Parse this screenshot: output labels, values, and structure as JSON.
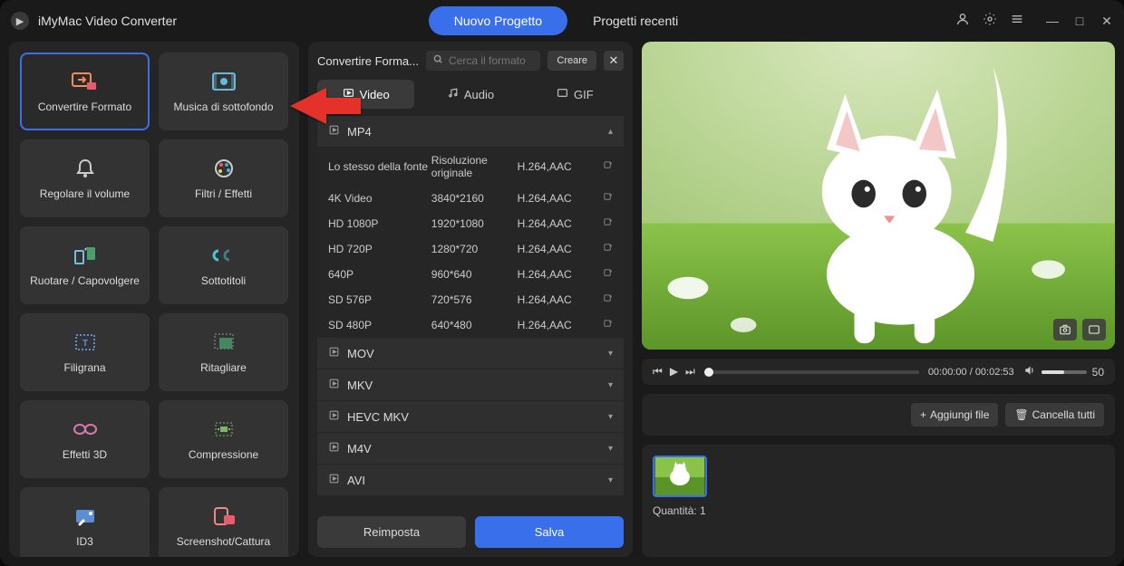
{
  "app": {
    "title": "iMyMac Video Converter"
  },
  "titlebar": {
    "new_project": "Nuovo Progetto",
    "recent_projects": "Progetti recenti"
  },
  "sidebar": {
    "tools": [
      {
        "label": "Convertire Formato",
        "active": true,
        "icon": "convert"
      },
      {
        "label": "Musica di sottofondo",
        "active": false,
        "icon": "film"
      },
      {
        "label": "Regolare il volume",
        "active": false,
        "icon": "bell"
      },
      {
        "label": "Filtri / Effetti",
        "active": false,
        "icon": "palette"
      },
      {
        "label": "Ruotare / Capovolgere",
        "active": false,
        "icon": "rotate"
      },
      {
        "label": "Sottotitoli",
        "active": false,
        "icon": "cc"
      },
      {
        "label": "Filigrana",
        "active": false,
        "icon": "watermark"
      },
      {
        "label": "Ritagliare",
        "active": false,
        "icon": "crop"
      },
      {
        "label": "Effetti 3D",
        "active": false,
        "icon": "glasses"
      },
      {
        "label": "Compressione",
        "active": false,
        "icon": "compress"
      },
      {
        "label": "ID3",
        "active": false,
        "icon": "id3"
      },
      {
        "label": "Screenshot/Cattura",
        "active": false,
        "icon": "screenshot"
      }
    ]
  },
  "middle": {
    "title": "Convertire Forma...",
    "search_placeholder": "Cerca il formato",
    "create": "Creare",
    "tabs": [
      {
        "label": "Video",
        "active": true
      },
      {
        "label": "Audio",
        "active": false
      },
      {
        "label": "GIF",
        "active": false
      }
    ],
    "groups": [
      {
        "name": "MP4",
        "expanded": true,
        "presets": [
          {
            "name": "Lo stesso della fonte",
            "res": "Risoluzione originale",
            "codec": "H.264,AAC"
          },
          {
            "name": "4K Video",
            "res": "3840*2160",
            "codec": "H.264,AAC"
          },
          {
            "name": "HD 1080P",
            "res": "1920*1080",
            "codec": "H.264,AAC"
          },
          {
            "name": "HD 720P",
            "res": "1280*720",
            "codec": "H.264,AAC"
          },
          {
            "name": "640P",
            "res": "960*640",
            "codec": "H.264,AAC"
          },
          {
            "name": "SD 576P",
            "res": "720*576",
            "codec": "H.264,AAC"
          },
          {
            "name": "SD 480P",
            "res": "640*480",
            "codec": "H.264,AAC"
          }
        ]
      },
      {
        "name": "MOV",
        "expanded": false
      },
      {
        "name": "MKV",
        "expanded": false
      },
      {
        "name": "HEVC MKV",
        "expanded": false
      },
      {
        "name": "M4V",
        "expanded": false
      },
      {
        "name": "AVI",
        "expanded": false
      }
    ],
    "reset": "Reimposta",
    "save": "Salva"
  },
  "player": {
    "current": "00:00:00",
    "total": "00:02:53",
    "volume": "50"
  },
  "filebar": {
    "add": "Aggiungi file",
    "clear": "Cancella tutti"
  },
  "thumbs": {
    "qty_label": "Quantità:",
    "qty_value": "1"
  }
}
